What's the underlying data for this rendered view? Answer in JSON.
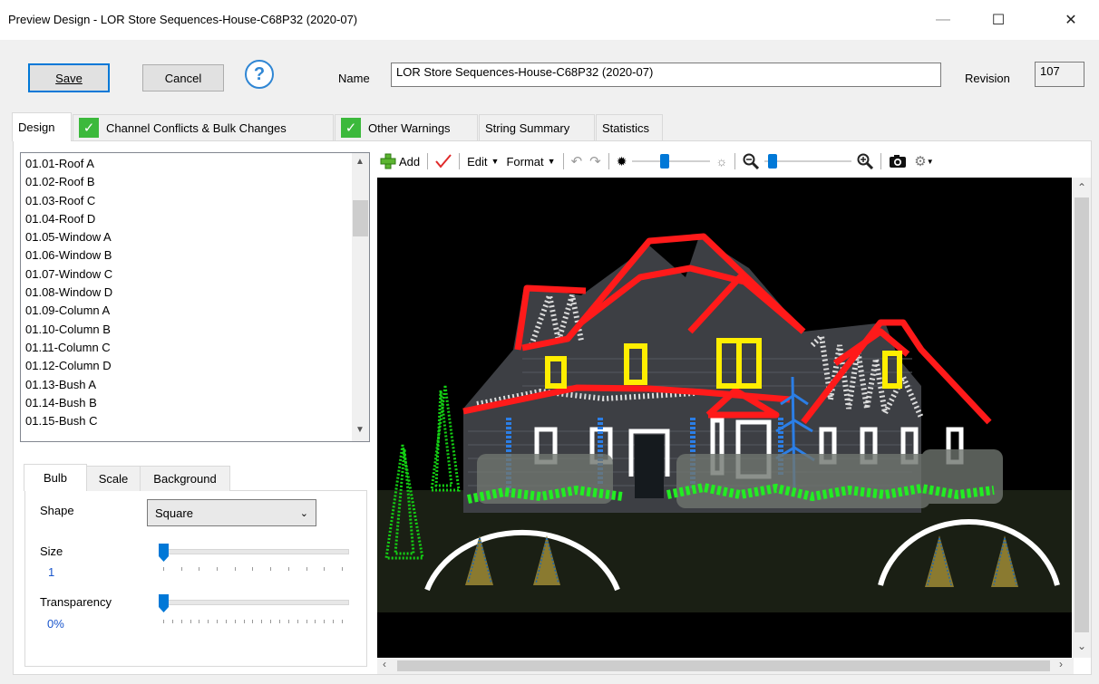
{
  "window": {
    "title": "Preview Design - LOR Store Sequences-House-C68P32 (2020-07)",
    "min": "—",
    "max": "☐",
    "close": "✕"
  },
  "header": {
    "save_label": "Save",
    "cancel_label": "Cancel",
    "help_glyph": "?",
    "name_label": "Name",
    "name_value": "LOR Store Sequences-House-C68P32 (2020-07)",
    "revision_label": "Revision",
    "revision_value": "107"
  },
  "tabs": [
    {
      "label": "Design",
      "active": true
    },
    {
      "label": "Channel Conflicts & Bulk Changes",
      "check": true
    },
    {
      "label": "Other Warnings",
      "check": true
    },
    {
      "label": "String Summary"
    },
    {
      "label": "Statistics"
    }
  ],
  "check_glyph": "✓",
  "channel_list": [
    "01.01-Roof A",
    "01.02-Roof B",
    "01.03-Roof C",
    "01.04-Roof D",
    "01.05-Window A",
    "01.06-Window B",
    "01.07-Window C",
    "01.08-Window D",
    "01.09-Column A",
    "01.10-Column B",
    "01.11-Column C",
    "01.12-Column D",
    "01.13-Bush A",
    "01.14-Bush B",
    "01.15-Bush C"
  ],
  "subtabs": [
    "Bulb",
    "Scale",
    "Background"
  ],
  "bulb": {
    "shape_label": "Shape",
    "shape_value": "Square",
    "size_label": "Size",
    "size_value": "1",
    "transparency_label": "Transparency",
    "transparency_value": "0%"
  },
  "toolbar": {
    "add_label": "Add",
    "edit_label": "Edit",
    "format_label": "Format",
    "icons": [
      "plus-icon",
      "checkmark-icon",
      "undo-icon",
      "redo-icon",
      "brightness-low-icon",
      "brightness-high-icon",
      "zoom-out-icon",
      "zoom-in-icon",
      "camera-icon",
      "gear-icon"
    ]
  },
  "colors": {
    "accent": "#0078d7",
    "check": "#3cb93c",
    "roof": "#ff1a1a",
    "window": "#ffee00",
    "bush": "#22ee22"
  }
}
